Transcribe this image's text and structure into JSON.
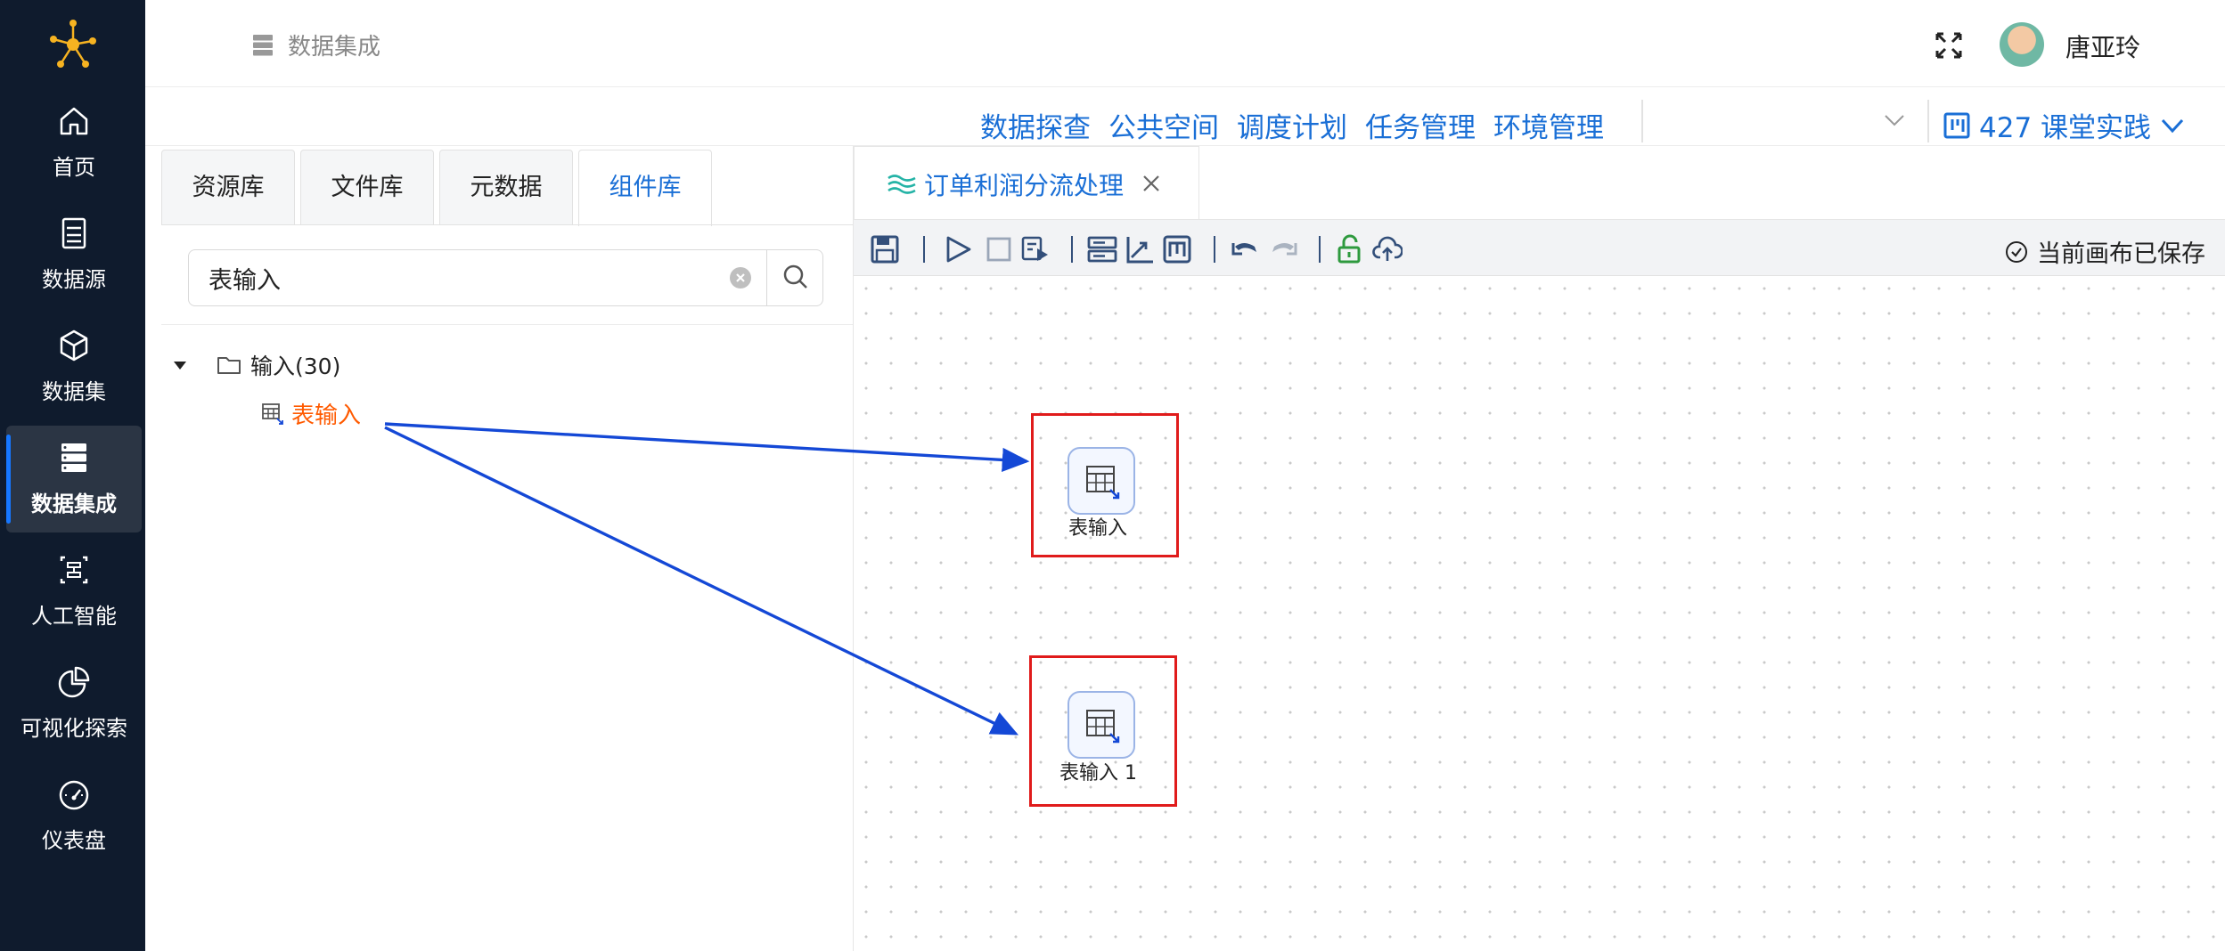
{
  "sidebar": {
    "items": [
      {
        "label": "首页",
        "icon": "home-icon"
      },
      {
        "label": "数据源",
        "icon": "database-icon"
      },
      {
        "label": "数据集",
        "icon": "cube-icon"
      },
      {
        "label": "数据集成",
        "icon": "server-stack-icon",
        "active": true
      },
      {
        "label": "人工智能",
        "icon": "ai-scan-icon"
      },
      {
        "label": "可视化探索",
        "icon": "pie-chart-icon"
      },
      {
        "label": "仪表盘",
        "icon": "gauge-icon"
      }
    ]
  },
  "header": {
    "breadcrumb": "数据集成",
    "username": "唐亚玲"
  },
  "subnav": {
    "links": [
      "数据探查",
      "公共空间",
      "调度计划",
      "任务管理",
      "环境管理"
    ],
    "project": "427 课堂实践"
  },
  "left_panel": {
    "tabs": [
      "资源库",
      "文件库",
      "元数据",
      "组件库"
    ],
    "active_tab": "组件库",
    "search_value": "表输入",
    "tree": {
      "folder": "输入(30)",
      "leaf": "表输入"
    }
  },
  "editor": {
    "tab_title": "订单利润分流处理",
    "status": "当前画布已保存",
    "nodes": [
      {
        "label": "表输入"
      },
      {
        "label": "表输入 1"
      }
    ]
  },
  "colors": {
    "sidebar_bg": "#0f1b2d",
    "accent": "#1a6fd6",
    "highlight": "#ff5a00",
    "annotation": "#e01b1b",
    "arrow": "#1448d6"
  }
}
